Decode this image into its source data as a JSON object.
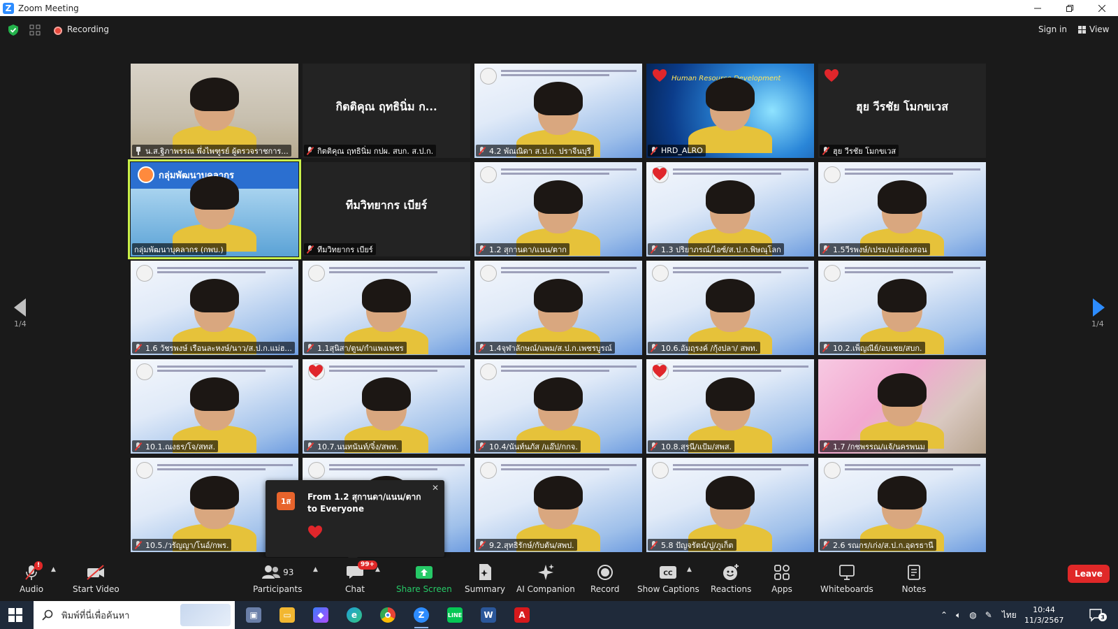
{
  "window": {
    "title": "Zoom Meeting",
    "controls": [
      "minimize",
      "restore",
      "close"
    ]
  },
  "topbar": {
    "recording_label": "Recording",
    "signin_label": "Sign in",
    "view_label": "View"
  },
  "pagination": {
    "left_count": "1/4",
    "right_count": "1/4"
  },
  "tiles": [
    {
      "name": "น.ส.ฐิภาพรรณ พึ่งไพฑูรย์ ผู้ตรวจราชการ...",
      "type": "video",
      "bg": "room",
      "icon": "pin-icon"
    },
    {
      "name": "กิตติคุณ ฤทธินิ่ม กปผ. สบก. ส.ป.ก.",
      "type": "name",
      "display_name": "กิตติคุณ ฤทธินิ่ม ก...",
      "icon": "mic-muted-icon"
    },
    {
      "name": "4.2 พัณณิดา ส.ป.ก. ปราจีนบุรี",
      "type": "video",
      "bg": "slide",
      "icon": "mic-muted-icon"
    },
    {
      "name": "HRD_ALRO",
      "type": "video",
      "bg": "hrd",
      "heart": true,
      "overlay_text": "Human Resource Development",
      "icon": "mic-muted-icon"
    },
    {
      "name": "ฮุย วีรชัย โมกขเวส",
      "type": "name",
      "display_name": "ฮุย วีรชัย โมกขเวส",
      "heart": true,
      "icon": "mic-muted-icon"
    },
    {
      "name": "กลุ่มพัฒนาบุคลากร (กพบ.)",
      "type": "video",
      "bg": "kpb",
      "active": true,
      "overlay_text": "กลุ่มพัฒนาบุคลากร",
      "icon": "none"
    },
    {
      "name": "ทีมวิทยากร เบียร์",
      "type": "name",
      "display_name": "ทีมวิทยากร เบียร์",
      "icon": "mic-muted-icon"
    },
    {
      "name": "1.2 สุกานดา/แนน/ตาก",
      "type": "video",
      "bg": "slide",
      "icon": "mic-muted-icon"
    },
    {
      "name": "1.3 ปริยาภรณ์/ไอซ์/ส.ป.ก.พิษณุโลก",
      "type": "video",
      "bg": "slide",
      "heart": true,
      "icon": "mic-muted-icon"
    },
    {
      "name": "1.5วีรพงษ์/เปรม/แม่ฮ่องสอน",
      "type": "video",
      "bg": "slide",
      "icon": "mic-muted-icon"
    },
    {
      "name": "1.6 วัชรพงษ์ เรือนละหงษ์/นาว/ส.ป.ก.แม่ฮ...",
      "type": "video",
      "bg": "slide",
      "icon": "mic-muted-icon"
    },
    {
      "name": "1.1สุนิสา/ตูน/กำแพงเพชร",
      "type": "video",
      "bg": "slide",
      "icon": "mic-muted-icon"
    },
    {
      "name": "1.4จุฬาลักษณ์/แพม/ส.ป.ก.เพชรบูรณ์",
      "type": "video",
      "bg": "slide",
      "icon": "mic-muted-icon"
    },
    {
      "name": "10.6.อัมฤรงค์ /กุ้งปลา/ สพท.",
      "type": "video",
      "bg": "slide",
      "icon": "mic-muted-icon"
    },
    {
      "name": "10.2.เพ็ญณีย์/อบเชย/สบก.",
      "type": "video",
      "bg": "slide",
      "icon": "mic-muted-icon"
    },
    {
      "name": "10.1.ณงธร/โจ/สทส.",
      "type": "video",
      "bg": "slide",
      "icon": "mic-muted-icon"
    },
    {
      "name": "10.7.นนทนันท์/จิ๋ง/สพท.",
      "type": "video",
      "bg": "slide",
      "heart": true,
      "icon": "mic-muted-icon"
    },
    {
      "name": "10.4/นันท์นภัส /แอ๊ป/กกจ.",
      "type": "video",
      "bg": "slide",
      "icon": "mic-muted-icon"
    },
    {
      "name": "10.8.สุรนี/แป้ม/สพส.",
      "type": "video",
      "bg": "slide",
      "heart": true,
      "icon": "mic-muted-icon"
    },
    {
      "name": "1.7 /กชพรรณ/แจ้/นครพนม",
      "type": "video",
      "bg": "pink",
      "icon": "mic-muted-icon"
    },
    {
      "name": "10.5./วรัญญา/โนอ์/กพร.",
      "type": "video",
      "bg": "slide",
      "icon": "mic-muted-icon"
    },
    {
      "name": "",
      "type": "video",
      "bg": "slide",
      "icon": "none"
    },
    {
      "name": "9.2.สุทธิรักษ์/กับตัน/สพป.",
      "type": "video",
      "bg": "slide",
      "icon": "mic-muted-icon"
    },
    {
      "name": "5.8 ปัญจรัตน์/ปู/ภูเก็ต",
      "type": "video",
      "bg": "slide",
      "icon": "mic-muted-icon"
    },
    {
      "name": "2.6 รณกร/เก่ง/ส.ป.ก.อุดรธานี",
      "type": "video",
      "bg": "slide",
      "icon": "mic-muted-icon"
    }
  ],
  "chat_popup": {
    "avatar_text": "1ส",
    "from_text": "From 1.2 สุกานดา/แนน/ตาก to Everyone",
    "message": "heart-emoji"
  },
  "toolbar": {
    "audio_label": "Audio",
    "audio_badge": "!",
    "start_video_label": "Start Video",
    "participants_label": "Participants",
    "participants_count": "93",
    "chat_label": "Chat",
    "chat_badge": "99+",
    "share_screen_label": "Share Screen",
    "summary_label": "Summary",
    "ai_companion_label": "AI Companion",
    "record_label": "Record",
    "show_captions_label": "Show Captions",
    "reactions_label": "Reactions",
    "apps_label": "Apps",
    "whiteboards_label": "Whiteboards",
    "notes_label": "Notes",
    "leave_label": "Leave",
    "share_color": "#26c967",
    "leave_color": "#e02828"
  },
  "taskbar": {
    "search_placeholder": "พิมพ์ที่นี่เพื่อค้นหา",
    "apps": [
      "photos-icon",
      "file-explorer-icon",
      "copilot-icon",
      "edge-icon",
      "chrome-icon",
      "zoom-icon",
      "line-icon",
      "word-icon",
      "acrobat-icon"
    ],
    "language": "ไทย",
    "time": "10:44",
    "date": "11/3/2567",
    "notification_count": "3"
  }
}
